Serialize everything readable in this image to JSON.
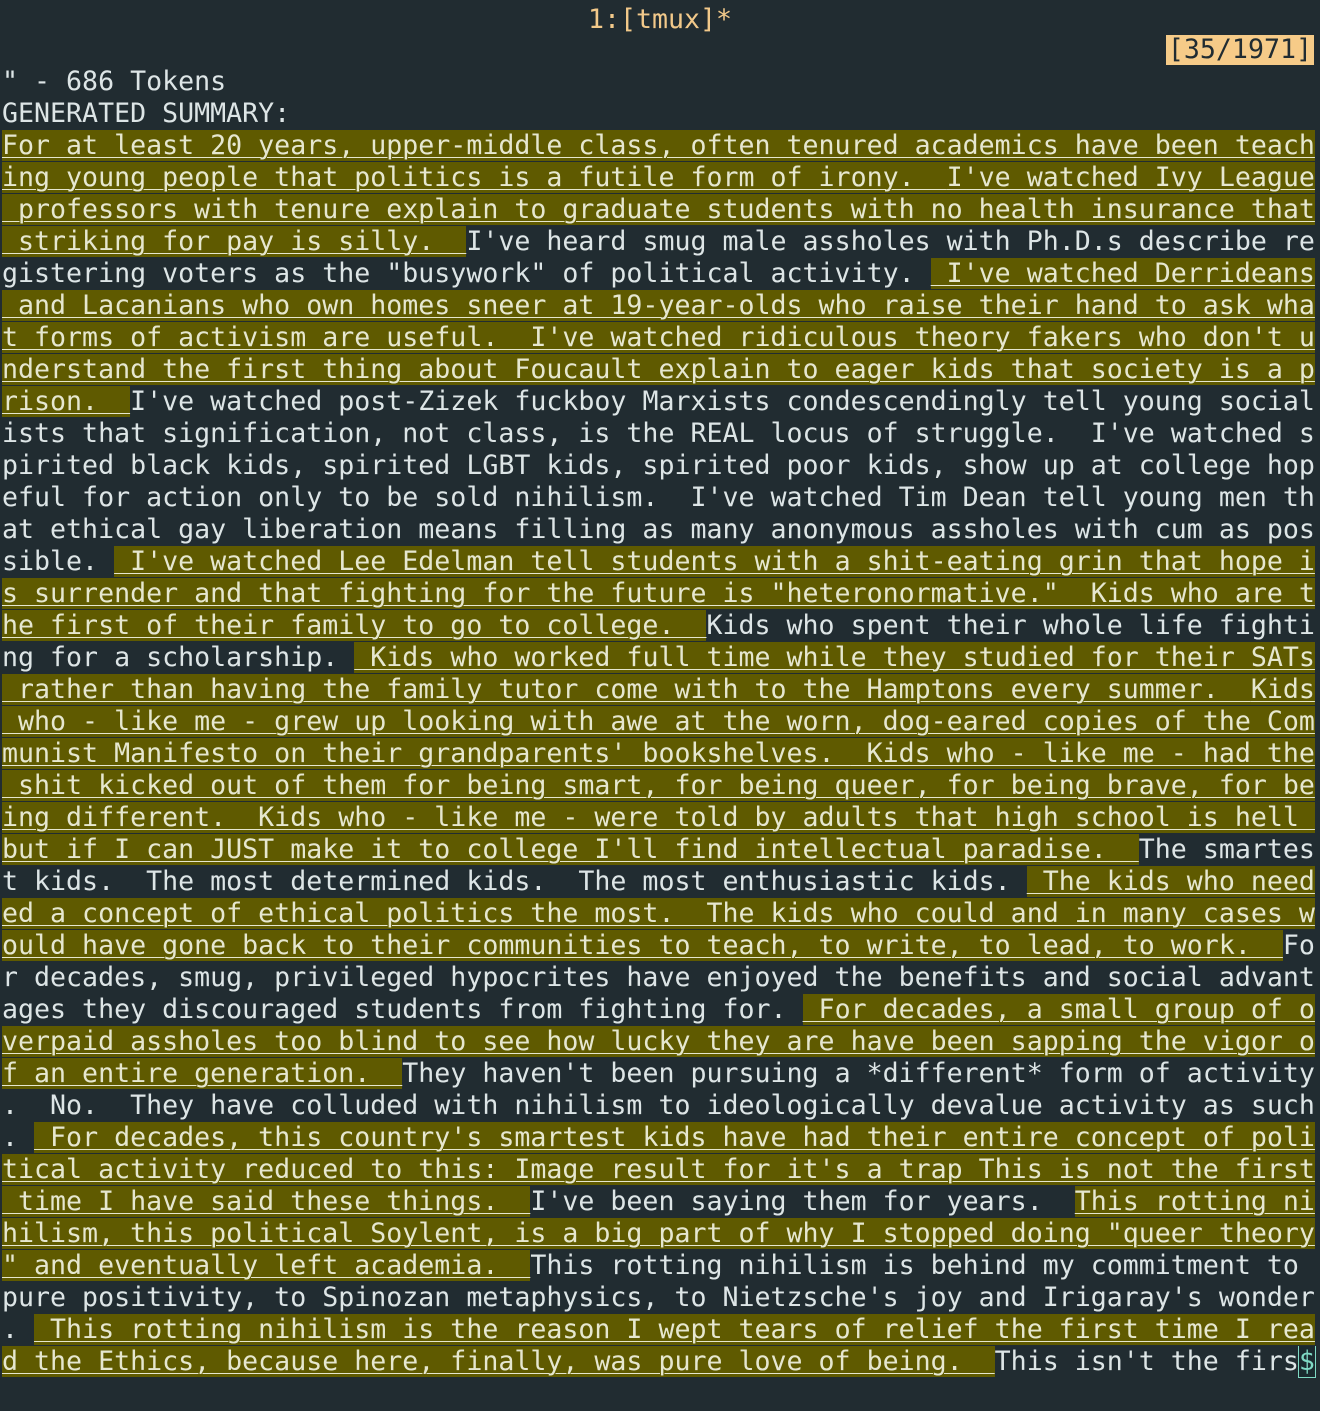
{
  "window": {
    "title": "1:[tmux]*",
    "position_indicator": "[35/1971]"
  },
  "pager": {
    "lines": [
      [
        {
          "t": "\" - 686 Tokens",
          "h": false
        }
      ],
      [
        {
          "t": "GENERATED SUMMARY:",
          "h": false
        }
      ],
      [
        {
          "t": "For at least 20 years, upper-middle class, often tenured academics have been teach",
          "h": true
        }
      ],
      [
        {
          "t": "ing young people that politics is a futile form of irony.  ",
          "h": true
        },
        {
          "t": "I've watched Ivy League",
          "h": true
        }
      ],
      [
        {
          "t": " professors with tenure explain to graduate students with no health insurance that",
          "h": true
        }
      ],
      [
        {
          "t": " striking for pay is silly.  ",
          "h": true
        },
        {
          "t": "I've heard smug male assholes with Ph.D.s describe re",
          "h": false
        }
      ],
      [
        {
          "t": "gistering voters as the \"busywork\" of political activity. ",
          "h": false
        },
        {
          "t": " I've watched Derrideans",
          "h": true
        }
      ],
      [
        {
          "t": " and Lacanians who own homes sneer at 19-year-olds who raise their hand to ask wha",
          "h": true
        }
      ],
      [
        {
          "t": "t forms of activism are useful.  I've watched ridiculous theory fakers who don't u",
          "h": true
        }
      ],
      [
        {
          "t": "nderstand the first thing about Foucault explain to eager kids that society is a p",
          "h": true
        }
      ],
      [
        {
          "t": "rison.  ",
          "h": true
        },
        {
          "t": "I've watched post-Zizek fuckboy Marxists condescendingly tell young social",
          "h": false
        }
      ],
      [
        {
          "t": "ists that signification, not class, is the REAL locus of struggle.  I've watched s",
          "h": false
        }
      ],
      [
        {
          "t": "pirited black kids, spirited LGBT kids, spirited poor kids, show up at college hop",
          "h": false
        }
      ],
      [
        {
          "t": "eful for action only to be sold nihilism.  I've watched Tim Dean tell young men th",
          "h": false
        }
      ],
      [
        {
          "t": "at ethical gay liberation means filling as many anonymous assholes with cum as pos",
          "h": false
        }
      ],
      [
        {
          "t": "sible. ",
          "h": false
        },
        {
          "t": " I've watched Lee Edelman tell students with a shit-eating grin that hope i",
          "h": true
        }
      ],
      [
        {
          "t": "s surrender and that fighting for the future is \"heteronormative.\"  ",
          "h": true
        },
        {
          "t": "Kids who are t",
          "h": true
        }
      ],
      [
        {
          "t": "he first of their family to go to college.  ",
          "h": true
        },
        {
          "t": "Kids who spent their whole life fighti",
          "h": false
        }
      ],
      [
        {
          "t": "ng for a scholarship. ",
          "h": false
        },
        {
          "t": " Kids who worked full time while they studied for their SATs",
          "h": true
        }
      ],
      [
        {
          "t": " rather than having the family tutor come with to the Hamptons every summer.  ",
          "h": true
        },
        {
          "t": "Kids",
          "h": true
        }
      ],
      [
        {
          "t": " who - like me - grew up looking with awe at the worn, dog-eared copies of the Com",
          "h": true
        }
      ],
      [
        {
          "t": "munist Manifesto on their grandparents' bookshelves. ",
          "h": true
        },
        {
          "t": " Kids who - like me - had the",
          "h": true
        }
      ],
      [
        {
          "t": " shit kicked out of them for being smart, for being queer, for being brave, for be",
          "h": true
        }
      ],
      [
        {
          "t": "ing different.  Kids who - like me - were told by adults that high school is hell ",
          "h": true
        }
      ],
      [
        {
          "t": "but if I can JUST make it to college I'll find intellectual paradise.  ",
          "h": true
        },
        {
          "t": "The smartes",
          "h": false
        }
      ],
      [
        {
          "t": "t kids.  The most determined kids.  The most enthusiastic kids. ",
          "h": false
        },
        {
          "t": " The kids who need",
          "h": true
        }
      ],
      [
        {
          "t": "ed a concept of ethical politics the most.  The kids who could and in many cases w",
          "h": true
        }
      ],
      [
        {
          "t": "ould have gone back to their communities to teach, to write, to lead, to work.  ",
          "h": true
        },
        {
          "t": "Fo",
          "h": false
        }
      ],
      [
        {
          "t": "r decades, smug, privileged hypocrites have enjoyed the benefits and social advant",
          "h": false
        }
      ],
      [
        {
          "t": "ages they discouraged students from fighting for. ",
          "h": false
        },
        {
          "t": " For decades, a small group of o",
          "h": true
        }
      ],
      [
        {
          "t": "verpaid assholes too blind to see how lucky they are have been sapping the vigor o",
          "h": true
        }
      ],
      [
        {
          "t": "f an entire generation.  ",
          "h": true
        },
        {
          "t": "They haven't been pursuing a *different* form of activity",
          "h": false
        }
      ],
      [
        {
          "t": ".  No.  They have colluded with nihilism to ideologically devalue activity as such",
          "h": false
        }
      ],
      [
        {
          "t": ". ",
          "h": false
        },
        {
          "t": " For decades, this country's smartest kids have had their entire concept of poli",
          "h": true
        }
      ],
      [
        {
          "t": "tical activity reduced to this: Image result for it's a trap This is not the first",
          "h": true
        }
      ],
      [
        {
          "t": " time I have said these things.  ",
          "h": true
        },
        {
          "t": "I've been saying them for years.  ",
          "h": false
        },
        {
          "t": "This rotting ni",
          "h": true
        }
      ],
      [
        {
          "t": "hilism, this political Soylent, is a big part of why I stopped doing \"queer theory",
          "h": true
        }
      ],
      [
        {
          "t": "\" and eventually left academia.  ",
          "h": true
        },
        {
          "t": "This rotting nihilism is behind my commitment to ",
          "h": false
        }
      ],
      [
        {
          "t": "pure positivity, to Spinozan metaphysics, to Nietzsche's joy and Irigaray's wonder",
          "h": false
        }
      ],
      [
        {
          "t": ". ",
          "h": false
        },
        {
          "t": " This rotting nihilism is the reason I wept tears of relief the first time I rea",
          "h": true
        }
      ],
      [
        {
          "t": "d the Ethics, because here, finally, was pure love of being.  ",
          "h": true
        },
        {
          "t": "This isn't the firs",
          "h": false
        },
        {
          "t": "$",
          "h": false,
          "c": true
        }
      ]
    ]
  }
}
